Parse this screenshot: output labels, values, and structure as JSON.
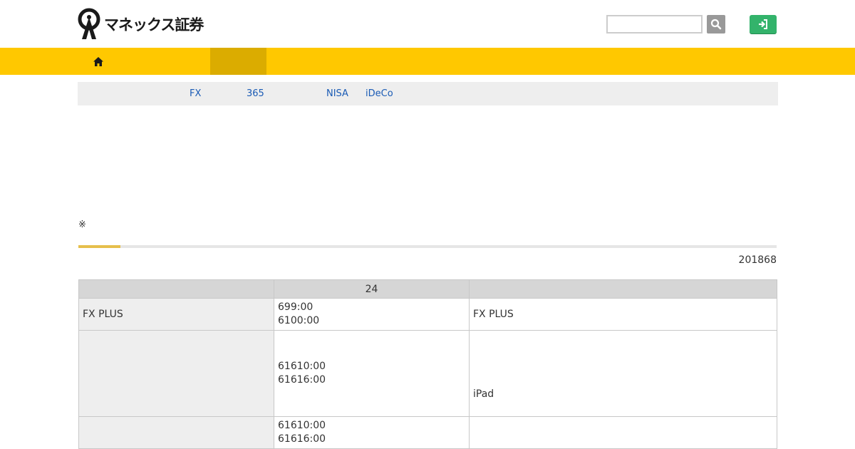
{
  "header": {
    "logo_text": "マネックス証券",
    "search": {
      "value": "",
      "placeholder": ""
    },
    "icons": {
      "search": "search-icon",
      "login": "sign-in-icon",
      "home": "home-icon"
    }
  },
  "colors": {
    "nav_bg": "#ffc800",
    "nav_active": "#dbac00",
    "login_btn": "#33b36b",
    "link": "#1a5bb5",
    "progress": "#e6bf4c"
  },
  "subnav": {
    "items": [
      {
        "label": "FX"
      },
      {
        "label": "365"
      },
      {
        "label": "NISA"
      },
      {
        "label": "iDeCo"
      }
    ]
  },
  "note": "※",
  "progress_fraction": 0.06,
  "date": "201868",
  "table": {
    "headers": [
      "",
      "24",
      ""
    ],
    "rows": [
      {
        "head": "FX PLUS",
        "times": [
          "699:00",
          "6100:00"
        ],
        "note": "FX PLUS"
      },
      {
        "head": "",
        "times": [
          "61610:00",
          "61616:00"
        ],
        "note": "iPad"
      },
      {
        "head": "",
        "times": [
          "61610:00",
          "61616:00"
        ],
        "note": ""
      }
    ]
  }
}
